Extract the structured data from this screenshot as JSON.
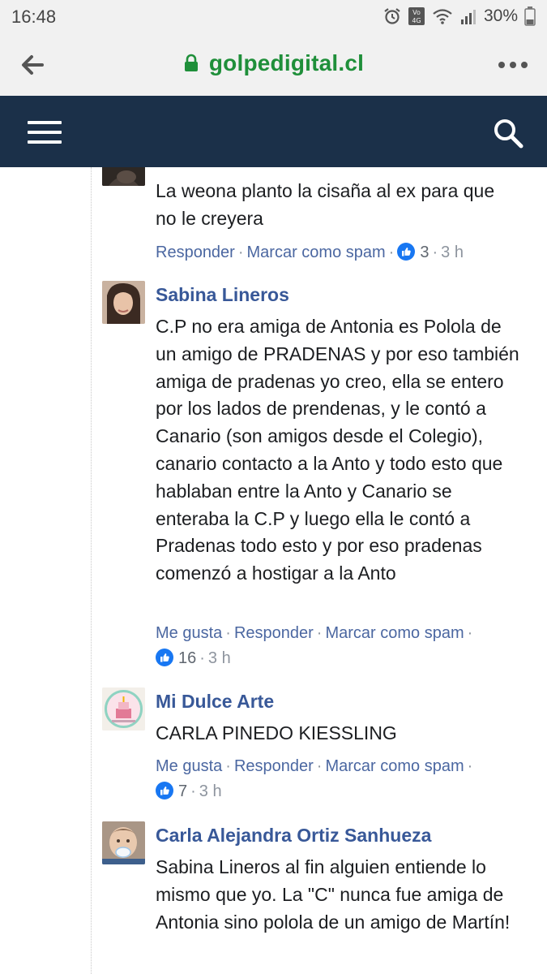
{
  "status_bar": {
    "time": "16:48",
    "battery": "30%"
  },
  "browser": {
    "url": "golpedigital.cl"
  },
  "colors": {
    "header_bg": "#1b3049",
    "link_blue": "#385898",
    "url_green": "#1f8f3a"
  },
  "comments": [
    {
      "author": "",
      "text": "La weona planto la cisaña al ex para que no le creyera",
      "actions": {
        "reply": "Responder",
        "spam": "Marcar como spam"
      },
      "likes": "3",
      "time": "3 h"
    },
    {
      "author": "Sabina Lineros",
      "text": "C.P no era amiga de Antonia es Pololа de un amigo de PRADENAS y por eso también amiga de pradenas yo creo, ella se entero por los lados de prendenas, y le contó a Canario (son amigos desde el Colegio), canario contacto a la Anto y todo esto que hablaban entre la Anto y Canario se enteraba la C.P y luego ella le contó a Pradenas todo esto y por eso pradenas comenzó a hostigar a la Anto",
      "actions": {
        "like": "Me gusta",
        "reply": "Responder",
        "spam": "Marcar como spam"
      },
      "likes": "16",
      "time": "3 h"
    },
    {
      "author": "Mi Dulce Arte",
      "text": "CARLA PINEDO KIESSLING",
      "actions": {
        "like": "Me gusta",
        "reply": "Responder",
        "spam": "Marcar como spam"
      },
      "likes": "7",
      "time": "3 h"
    },
    {
      "author": "Carla Alejandra Ortiz Sanhueza",
      "text": "Sabina Lineros al fin alguien entiende lo mismo que yo. La \"C\" nunca fue amiga de Antonia sino pololа de un amigo de Martín!"
    }
  ]
}
